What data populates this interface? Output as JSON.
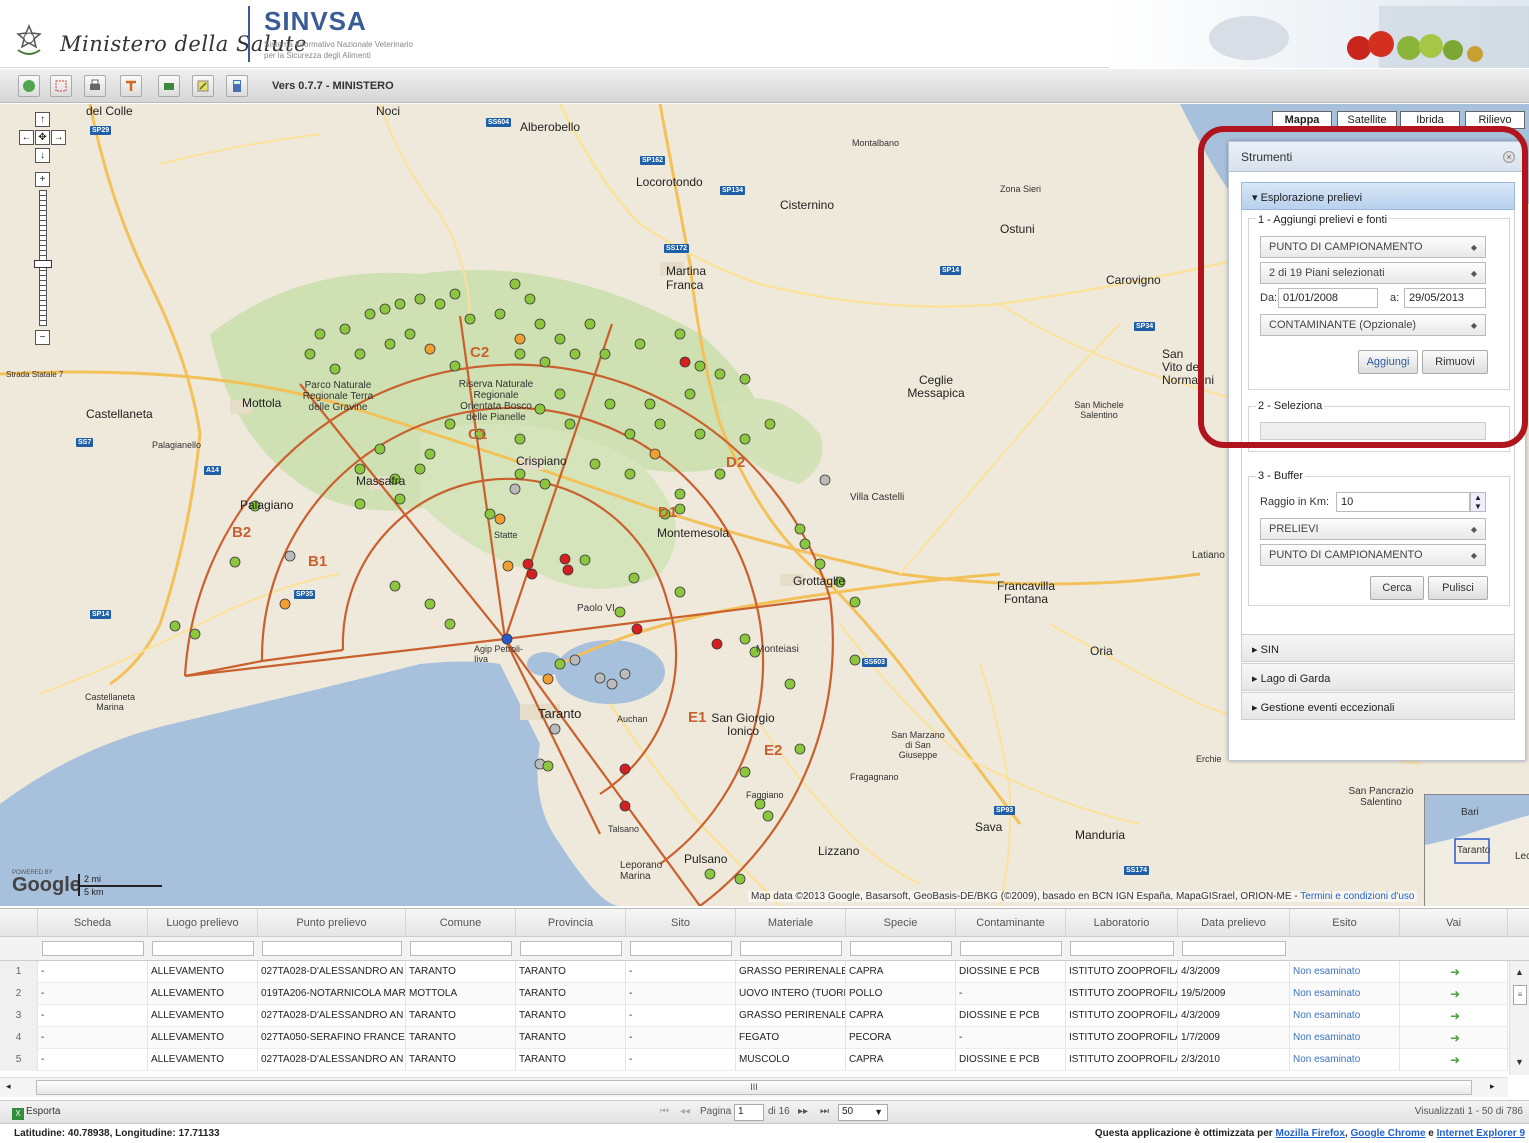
{
  "header": {
    "ministry_name": "Ministero della Salute",
    "app_name": "SINVSA",
    "app_desc_line1": "Sistema Informativo Nazionale Veterinario",
    "app_desc_line2": "per la Sicurezza degli Alimenti"
  },
  "toolbar": {
    "version": "Vers 0.7.7 - MINISTERO",
    "buttons": [
      "globe-icon",
      "select-box-icon",
      "print-icon",
      "measure-icon",
      "layers-icon",
      "export-map-icon",
      "calculator-icon"
    ]
  },
  "map": {
    "type_buttons": [
      "Mappa",
      "Satellite",
      "Ibrida",
      "Rilievo"
    ],
    "active_type": "Mappa",
    "towns": [
      {
        "name": "del Colle"
      },
      {
        "name": "Noci"
      },
      {
        "name": "Alberobello"
      },
      {
        "name": "Montalbano"
      },
      {
        "name": "Locorotondo"
      },
      {
        "name": "Cisternino"
      },
      {
        "name": "Zona Sieri"
      },
      {
        "name": "Ostuni"
      },
      {
        "name": "Martina Franca"
      },
      {
        "name": "Carovigno"
      },
      {
        "name": "Parco Naturale Regionale Terra delle Gravine"
      },
      {
        "name": "Riserva Naturale Regionale Orientata Bosco delle Pianelle"
      },
      {
        "name": "Mottola"
      },
      {
        "name": "Castellaneta"
      },
      {
        "name": "Palagianello"
      },
      {
        "name": "Ceglie Messapica"
      },
      {
        "name": "San Michele Salentino"
      },
      {
        "name": "Massafra"
      },
      {
        "name": "Crispiano"
      },
      {
        "name": "Palagiano"
      },
      {
        "name": "Statte"
      },
      {
        "name": "Montemesola"
      },
      {
        "name": "Villa Castelli"
      },
      {
        "name": "Grottaglie"
      },
      {
        "name": "Francavilla Fontana"
      },
      {
        "name": "Paolo VI"
      },
      {
        "name": "Oria"
      },
      {
        "name": "Agip Petroli-Iiva"
      },
      {
        "name": "Castellaneta Marina"
      },
      {
        "name": "Monteiasi"
      },
      {
        "name": "Taranto"
      },
      {
        "name": "Auchan"
      },
      {
        "name": "San Giorgio Ionico"
      },
      {
        "name": "San Marzano di San Giuseppe"
      },
      {
        "name": "Fragagnano"
      },
      {
        "name": "Faggiano"
      },
      {
        "name": "Sava"
      },
      {
        "name": "Manduria"
      },
      {
        "name": "Lizzano"
      },
      {
        "name": "Talsano"
      },
      {
        "name": "Leporano Marina"
      },
      {
        "name": "Pulsano"
      },
      {
        "name": "San Pancrazio Salentino"
      },
      {
        "name": "Erchie"
      },
      {
        "name": "Latiano"
      },
      {
        "name": "Strada Statale 7"
      },
      {
        "name": "San Vito dei Normanni"
      }
    ],
    "zones": [
      "C2",
      "C1",
      "D2",
      "D1",
      "B2",
      "B1",
      "E1",
      "E2"
    ],
    "scale": {
      "mi": "2 mi",
      "km": "5 km"
    },
    "attribution": "Map data ©2013 Google, Basarsoft, GeoBasis-DE/BKG (©2009), basado en BCN IGN España, MapaGISrael, ORION-ME -",
    "terms_link": "Termini e condizioni d'uso",
    "powered_by": "POWERED BY",
    "google_logo": "Google",
    "overview_labels": [
      "Bari",
      "Taranto",
      "Lecce"
    ],
    "colors": {
      "zone_lines": "#c9602e",
      "point_green": "#8cc63f",
      "point_orange": "#f0a030",
      "point_red": "#d42020",
      "point_grey": "#bbbbbb",
      "point_blue": "#2a5ad0"
    }
  },
  "strumenti": {
    "title": "Strumenti",
    "sections": {
      "esplorazione": {
        "title": "Esplorazione prelievi",
        "step1_title": "1 - Aggiungi prelievi e fonti",
        "combo_punto": "PUNTO DI CAMPIONAMENTO",
        "combo_piani": "2 di 19 Piani selezionati",
        "da_label": "Da:",
        "da_value": "01/01/2008",
        "a_label": "a:",
        "a_value": "29/05/2013",
        "combo_contaminante": "CONTAMINANTE (Opzionale)",
        "btn_aggiungi": "Aggiungi",
        "btn_rimuovi": "Rimuovi",
        "step2_title": "2 - Seleziona",
        "step3_title": "3 - Buffer",
        "raggio_label": "Raggio in Km:",
        "raggio_value": "10",
        "combo_prelievi": "PRELIEVI",
        "combo_punto2": "PUNTO DI CAMPIONAMENTO",
        "btn_cerca": "Cerca",
        "btn_pulisci": "Pulisci"
      },
      "others": [
        "SIN",
        "Lago di Garda",
        "Gestione eventi eccezionali"
      ]
    }
  },
  "grid": {
    "columns": [
      "Scheda",
      "Luogo prelievo",
      "Punto prelievo",
      "Comune",
      "Provincia",
      "Sito",
      "Materiale",
      "Specie",
      "Contaminante",
      "Laboratorio",
      "Data prelievo",
      "Esito",
      "Vai"
    ],
    "rows": [
      {
        "n": "1",
        "scheda": "-",
        "luogo": "ALLEVAMENTO",
        "punto": "027TA028-D'ALESSANDRO AN",
        "comune": "TARANTO",
        "provincia": "TARANTO",
        "sito": "-",
        "materiale": "GRASSO PERIRENALE",
        "specie": "CAPRA",
        "contaminante": "DIOSSINE E PCB",
        "laboratorio": "ISTITUTO ZOOPROFILA",
        "data": "4/3/2009",
        "esito": "Non esaminato"
      },
      {
        "n": "2",
        "scheda": "-",
        "luogo": "ALLEVAMENTO",
        "punto": "019TA206-NOTARNICOLA MAR",
        "comune": "MOTTOLA",
        "provincia": "TARANTO",
        "sito": "-",
        "materiale": "UOVO INTERO (TUORLI",
        "specie": "POLLO",
        "contaminante": "-",
        "laboratorio": "ISTITUTO ZOOPROFILA",
        "data": "19/5/2009",
        "esito": "Non esaminato"
      },
      {
        "n": "3",
        "scheda": "-",
        "luogo": "ALLEVAMENTO",
        "punto": "027TA028-D'ALESSANDRO AN",
        "comune": "TARANTO",
        "provincia": "TARANTO",
        "sito": "-",
        "materiale": "GRASSO PERIRENALE",
        "specie": "CAPRA",
        "contaminante": "DIOSSINE E PCB",
        "laboratorio": "ISTITUTO ZOOPROFILA",
        "data": "4/3/2009",
        "esito": "Non esaminato"
      },
      {
        "n": "4",
        "scheda": "-",
        "luogo": "ALLEVAMENTO",
        "punto": "027TA050-SERAFINO FRANCE",
        "comune": "TARANTO",
        "provincia": "TARANTO",
        "sito": "-",
        "materiale": "FEGATO",
        "specie": "PECORA",
        "contaminante": "-",
        "laboratorio": "ISTITUTO ZOOPROFILA",
        "data": "1/7/2009",
        "esito": "Non esaminato"
      },
      {
        "n": "5",
        "scheda": "-",
        "luogo": "ALLEVAMENTO",
        "punto": "027TA028-D'ALESSANDRO AN",
        "comune": "TARANTO",
        "provincia": "TARANTO",
        "sito": "-",
        "materiale": "MUSCOLO",
        "specie": "CAPRA",
        "contaminante": "DIOSSINE E PCB",
        "laboratorio": "ISTITUTO ZOOPROFILA",
        "data": "2/3/2010",
        "esito": "Non esaminato"
      }
    ],
    "h_scroll_grip": "III"
  },
  "pager": {
    "export_label": "Esporta",
    "page_label": "Pagina",
    "page_value": "1",
    "of_label": "di 16",
    "page_size": "50",
    "summary": "Visualizzati 1 - 50 di 786"
  },
  "status": {
    "coords": "Latitudine: 40.78938, Longitudine: 17.71133",
    "browser_note_prefix": "Questa applicazione è ottimizzata per",
    "firefox": "Mozilla Firefox",
    "chrome": "Google Chrome",
    "ie": "Internet Explorer 9",
    "and_word": "e"
  }
}
